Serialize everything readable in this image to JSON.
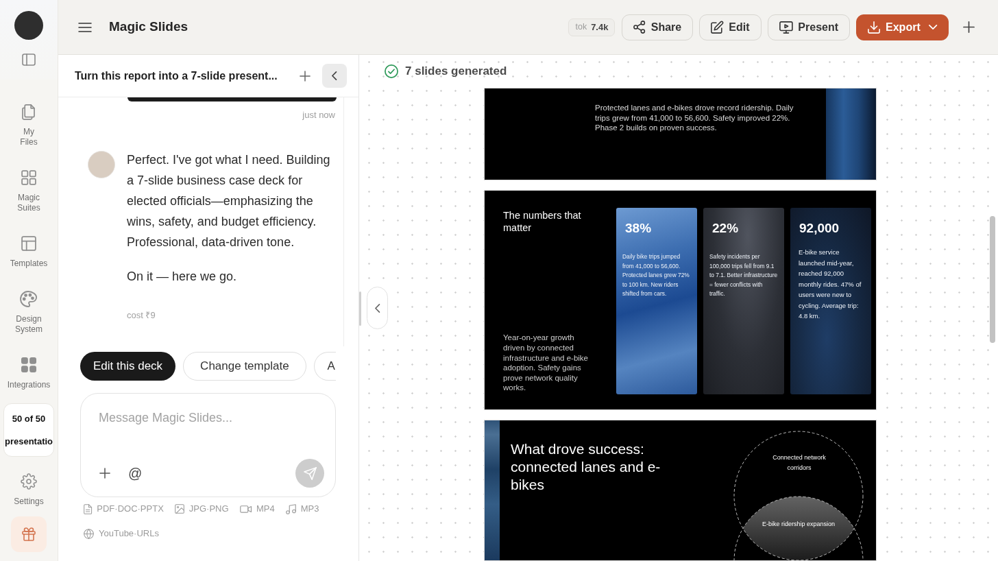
{
  "sidebar": {
    "items": [
      {
        "label": "My Files",
        "kind": "files"
      },
      {
        "label": "Magic Suites",
        "kind": "suites"
      },
      {
        "label": "Templates",
        "kind": "templates"
      },
      {
        "label": "Design System",
        "kind": "design"
      },
      {
        "label": "Integrations",
        "kind": "integrations"
      }
    ],
    "usage": {
      "count": "50 of 50",
      "unit": "presentatio"
    },
    "footer_items": [
      {
        "label": "Settings",
        "kind": "settings"
      }
    ]
  },
  "top_bar": {
    "title": "Magic Slides",
    "tokens": {
      "label": "tok",
      "value": "7.4k"
    },
    "buttons": [
      {
        "label": "Share",
        "kind": "share"
      },
      {
        "label": "Edit",
        "kind": "edit"
      },
      {
        "label": "Present",
        "kind": "present"
      },
      {
        "label": "Export",
        "kind": "export"
      }
    ]
  },
  "chat": {
    "title": "Turn this report into a 7-slide present...",
    "messages": [
      {
        "kind": "user",
        "time": "just now"
      },
      {
        "kind": "assistant",
        "paragraphs": [
          "Perfect. I've got what I need. Building a 7-slide business case deck for elected officials—emphasizing the wins, safety, and budget efficiency. Professional, data-driven tone.",
          "On it — here we go."
        ],
        "cost": "cost ₹9"
      }
    ],
    "suggestions": [
      {
        "label": "Edit this deck",
        "kind": "primary"
      },
      {
        "label": "Change template",
        "kind": "outline"
      },
      {
        "label": "A",
        "kind": "partial"
      }
    ],
    "composer": {
      "placeholder": "Message Magic Slides...",
      "mention": "@"
    },
    "attachments": [
      {
        "label": "PDF·DOC·PPTX",
        "kind": "document"
      },
      {
        "label": "JPG·PNG",
        "kind": "image"
      },
      {
        "label": "MP4",
        "kind": "video"
      },
      {
        "label": "MP3",
        "kind": "audio"
      },
      {
        "label": "YouTube·URLs",
        "kind": "web"
      }
    ]
  },
  "canvas": {
    "status": "7 slides generated",
    "slides": [
      {
        "kind": "summary",
        "body": "Protected lanes and e-bikes drove record ridership. Daily trips grew from 41,000 to 56,600. Safety improved 22%. Phase 2 builds on proven success."
      },
      {
        "kind": "stats",
        "title": "The numbers that matter",
        "note": "Year-on-year growth driven by connected infrastructure and e-bike adoption. Safety gains prove network quality works.",
        "stats": [
          {
            "value": "38%",
            "text": "Daily bike trips jumped from 41,000 to 56,600. Protected lanes grew 72% to 100 km. New riders shifted from cars."
          },
          {
            "value": "22%",
            "text": "Safety incidents per 100,000 trips fell from 9.1 to 7.1. Better infrastructure = fewer conflicts with traffic."
          },
          {
            "value": "92,000",
            "text": "E-bike service launched mid-year, reached 92,000 monthly rides. 47% of users were new to cycling. Average trip: 4.8 km."
          }
        ]
      },
      {
        "kind": "venn",
        "title": "What drove success: connected lanes and e-bikes",
        "circles": [
          "Connected network corridors",
          "E-bike ridership expansion"
        ]
      }
    ]
  }
}
